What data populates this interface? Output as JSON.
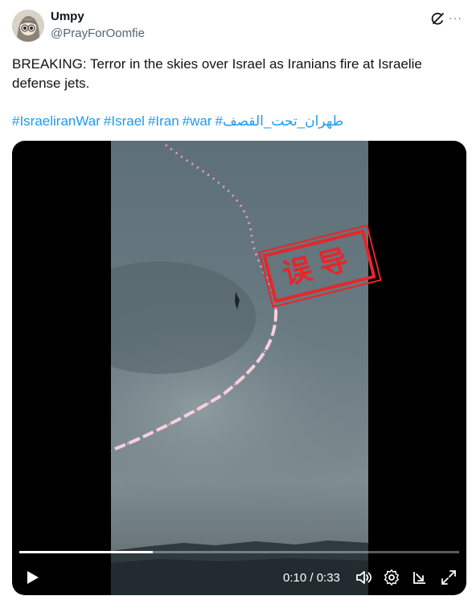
{
  "user": {
    "display_name": "Umpy",
    "handle": "@PrayForOomfie"
  },
  "tweet": {
    "text": "BREAKING: Terror in the skies over Israel as Iranians fire at Israelie defense jets.",
    "hashtags": [
      "#IsraeliranWar",
      "#Israel",
      "#Iran",
      "#war",
      "#طهران_تحت_القصف"
    ]
  },
  "video": {
    "stamp_text": "误导",
    "time_current": "0:10",
    "time_total": "0:33",
    "time_display": "0:10 / 0:33",
    "progress": 0.303
  },
  "icons": {
    "grok": "grok-icon",
    "more": "more-options-icon",
    "play": "play-icon",
    "volume": "volume-icon",
    "settings": "settings-gear-icon",
    "popout": "popout-icon",
    "fullscreen": "fullscreen-icon"
  },
  "colors": {
    "link": "#1d9bf0",
    "stamp": "#e6262a",
    "secondary_text": "#536471"
  }
}
